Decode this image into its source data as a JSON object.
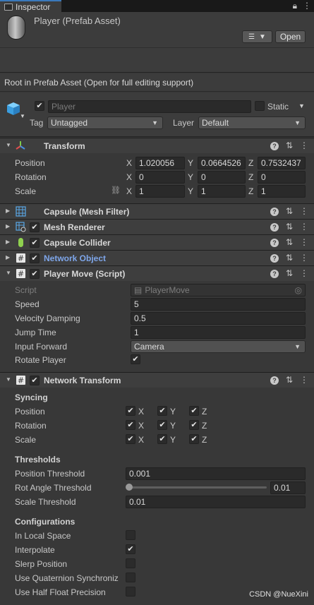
{
  "tab": {
    "title": "Inspector"
  },
  "header": {
    "title": "Player (Prefab Asset)",
    "open_label": "Open",
    "notice": "Root in Prefab Asset (Open for full editing support)"
  },
  "gameobject": {
    "name_placeholder": "Player",
    "static_label": "Static",
    "tag_label": "Tag",
    "tag_value": "Untagged",
    "layer_label": "Layer",
    "layer_value": "Default"
  },
  "transform": {
    "title": "Transform",
    "position_label": "Position",
    "rotation_label": "Rotation",
    "scale_label": "Scale",
    "position": {
      "x": "1.020056",
      "y": "0.0664526",
      "z": "0.7532437"
    },
    "rotation": {
      "x": "0",
      "y": "0",
      "z": "0"
    },
    "scale": {
      "x": "1",
      "y": "1",
      "z": "1"
    },
    "axis_x": "X",
    "axis_y": "Y",
    "axis_z": "Z"
  },
  "components": {
    "mesh_filter": "Capsule (Mesh Filter)",
    "mesh_renderer": "Mesh Renderer",
    "capsule_collider": "Capsule Collider",
    "network_object": "Network Object",
    "player_move": "Player Move (Script)",
    "network_transform": "Network Transform"
  },
  "player_move": {
    "script_label": "Script",
    "script_value": "PlayerMove",
    "speed_label": "Speed",
    "speed": "5",
    "damping_label": "Velocity Damping",
    "damping": "0.5",
    "jump_label": "Jump Time",
    "jump": "1",
    "input_label": "Input Forward",
    "input": "Camera",
    "rotate_label": "Rotate Player"
  },
  "network_transform": {
    "syncing": "Syncing",
    "position": "Position",
    "rotation": "Rotation",
    "scale": "Scale",
    "thresholds": "Thresholds",
    "pos_thr_label": "Position Threshold",
    "pos_thr": "0.001",
    "rot_thr_label": "Rot Angle Threshold",
    "rot_thr": "0.01",
    "scale_thr_label": "Scale Threshold",
    "scale_thr": "0.01",
    "configurations": "Configurations",
    "local_space": "In Local Space",
    "interpolate": "Interpolate",
    "slerp": "Slerp Position",
    "quaternion": "Use Quaternion Synchroniz",
    "half_float": "Use Half Float Precision"
  },
  "watermark": "CSDN @NueXini",
  "colors": {
    "link": "#7ea6ea",
    "tab_accent": "#3a79bb"
  }
}
